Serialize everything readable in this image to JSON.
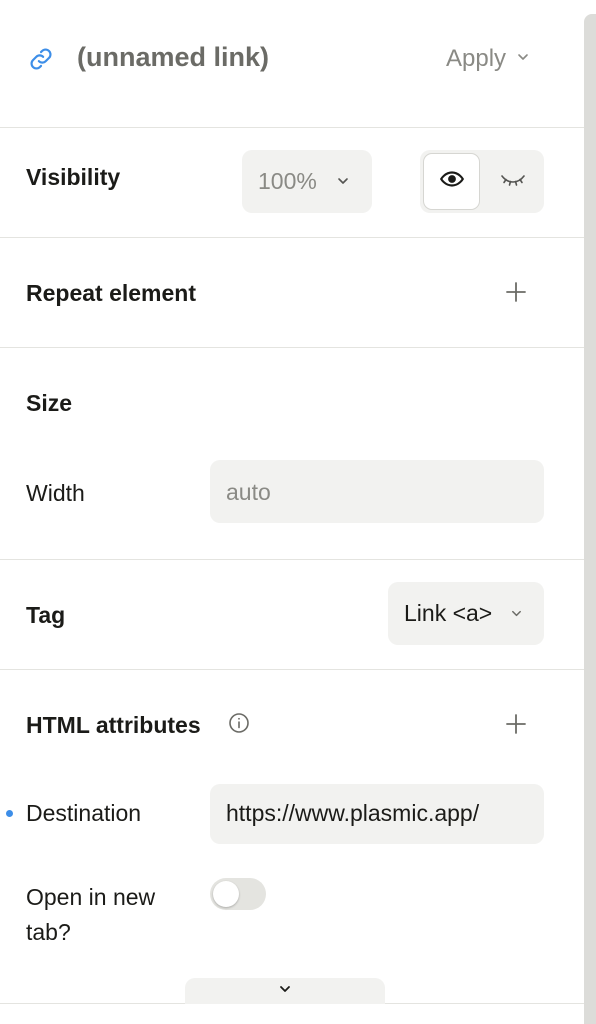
{
  "header": {
    "title": "(unnamed link)",
    "apply_label": "Apply"
  },
  "visibility": {
    "label": "Visibility",
    "opacity_value": "100%",
    "mode_selected": "visible"
  },
  "repeat": {
    "label": "Repeat element"
  },
  "size": {
    "label": "Size",
    "width_label": "Width",
    "width_placeholder": "auto"
  },
  "tag": {
    "label": "Tag",
    "value": "Link <a>"
  },
  "html_attributes": {
    "label": "HTML attributes",
    "destination_label": "Destination",
    "destination_value": "https://www.plasmic.app/",
    "new_tab_label": "Open in new tab?",
    "new_tab_enabled": false
  },
  "colors": {
    "accent": "#3d8ee8",
    "field_bg": "#f2f2f0",
    "divider": "#e4e4e0",
    "muted_text": "#8a8a85"
  },
  "icons": {
    "link": "link-icon",
    "apply_chevron": "chevron-down-icon",
    "eye": "eye-icon",
    "eye_closed": "eye-closed-icon",
    "plus": "plus-icon",
    "info": "info-icon",
    "expand": "chevron-down-icon"
  }
}
